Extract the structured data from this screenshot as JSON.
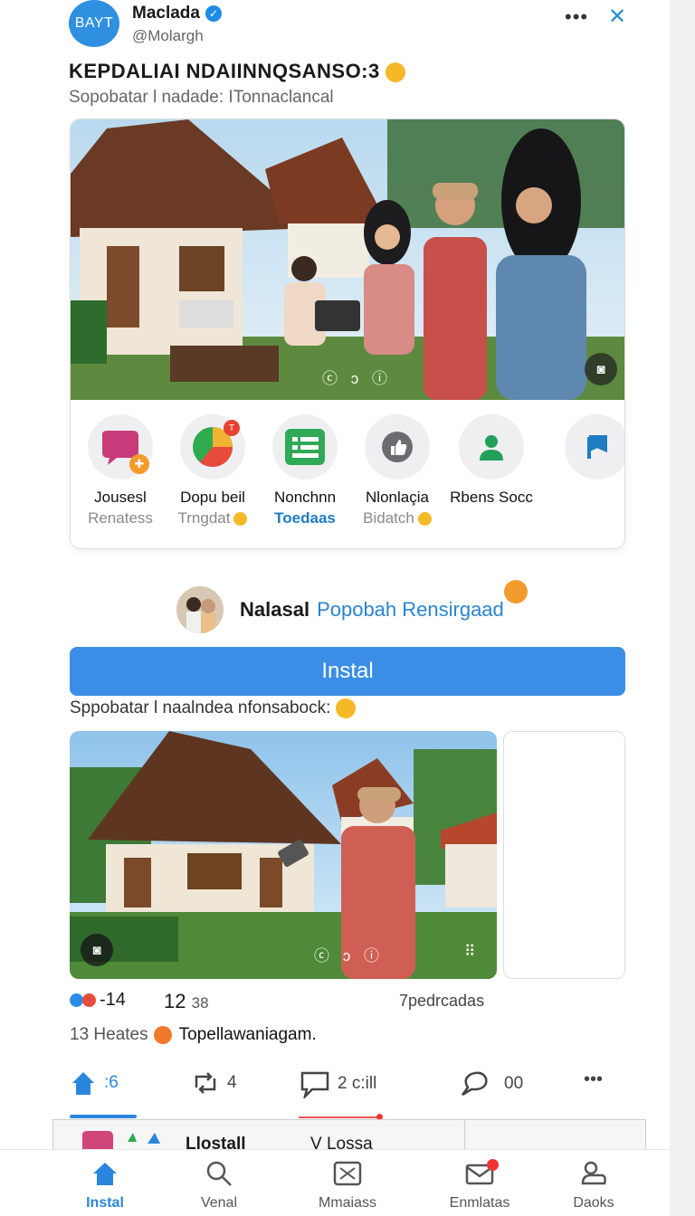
{
  "header": {
    "logo_text": "BAYT",
    "username": "Maclada",
    "handle": "@Molargh",
    "more_icon": "more-horizontal-icon",
    "close_icon": "close-icon"
  },
  "post": {
    "title": "KEPDALIAI NDAIINNQSANSO:3",
    "subtitle": "Sopobatar l nadade: ITonnaclancal"
  },
  "photo1": {
    "controls": "ⓒ ɔ ⓘ"
  },
  "apps": [
    {
      "name": "Jousesl",
      "sub": "Renatess"
    },
    {
      "name": "Dopu beil",
      "sub": "Trngdat"
    },
    {
      "name": "Nonchnn",
      "sub": "Toedaas"
    },
    {
      "name": "Nlonlaçia",
      "sub": "Bidatch"
    },
    {
      "name": "Rbens Socc",
      "sub": ""
    }
  ],
  "recommend": {
    "name": "Nalasal",
    "link": "Popobah Rensirgaad"
  },
  "install_button": "Instal",
  "caption2": "Sppobatar l naalndea nfonsabock:",
  "photo2": {
    "controls": "ⓒ ɔ ⓘ",
    "grip": "⠿"
  },
  "stats": {
    "reactions": "-14",
    "count": "12",
    "count_small": "38",
    "shares": "7pedrcadas"
  },
  "likes": {
    "count_text": "13 Heates",
    "text": "Topellawaniagam."
  },
  "actions": {
    "home_count": ":6",
    "retweet_count": "4",
    "comment_count": "2 c:ill",
    "reply_count": "00",
    "more": "•••"
  },
  "peek": {
    "title": "Llostall",
    "title2": "V Lossa"
  },
  "tabs": [
    {
      "label": "Instal",
      "icon": "home-icon"
    },
    {
      "label": "Venal",
      "icon": "search-icon"
    },
    {
      "label": "Mmaiass",
      "icon": "image-icon"
    },
    {
      "label": "Enmlatas",
      "icon": "mail-icon"
    },
    {
      "label": "Daoks",
      "icon": "profile-icon"
    }
  ],
  "colors": {
    "accent": "#3a8ee6",
    "link": "#2a84d0",
    "badge": "#e33333"
  }
}
